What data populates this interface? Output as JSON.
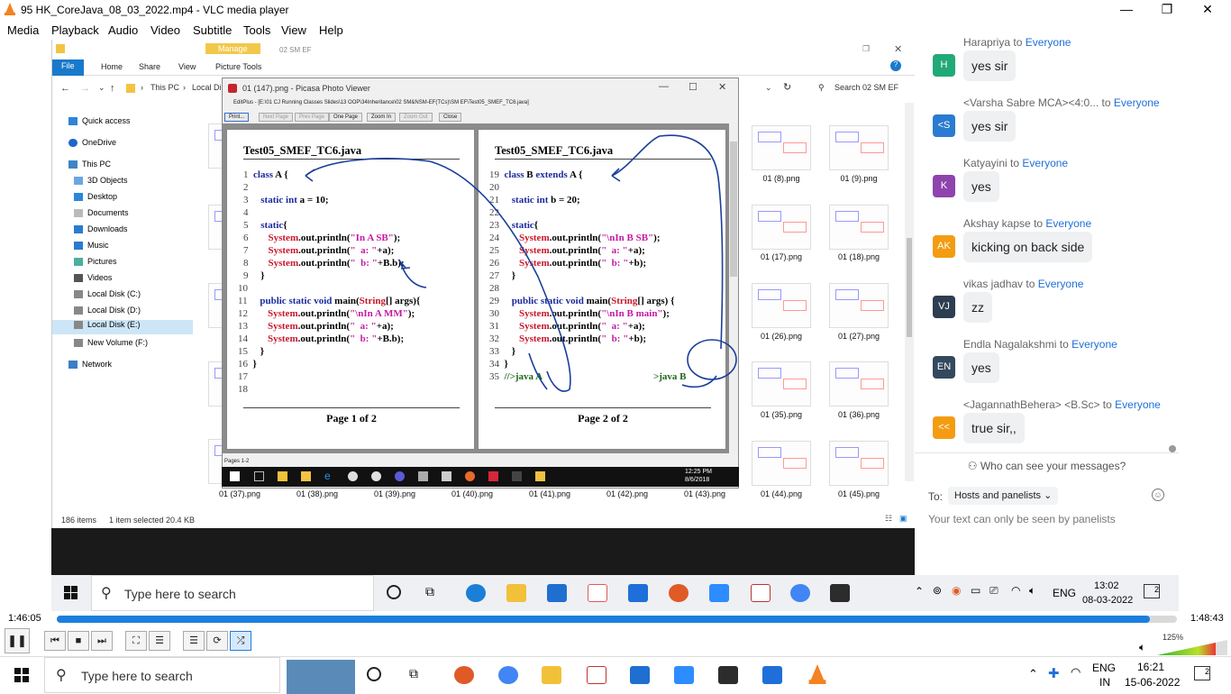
{
  "window": {
    "title": "95 HK_CoreJava_08_03_2022.mp4 - VLC media player"
  },
  "menu": [
    "Media",
    "Playback",
    "Audio",
    "Video",
    "Subtitle",
    "Tools",
    "View",
    "Help"
  ],
  "explorer": {
    "manage_tab": "Manage",
    "window_title": "02 SM EF",
    "ribbon": [
      "File",
      "Home",
      "Share",
      "View",
      "Picture Tools"
    ],
    "path": [
      "This PC",
      "Local Di"
    ],
    "search_placeholder": "Search 02 SM EF",
    "sidebar": [
      "Quick access",
      "OneDrive",
      "This PC",
      "3D Objects",
      "Desktop",
      "Documents",
      "Downloads",
      "Music",
      "Pictures",
      "Videos",
      "Local Disk (C:)",
      "Local Disk (D:)",
      "Local Disk (E:)",
      "New Volume (F:)",
      "Network"
    ],
    "right_thumbs": [
      "01 (8).png",
      "01 (9).png",
      "01 (17).png",
      "01 (18).png",
      "01 (26).png",
      "01 (27).png",
      "01 (35).png",
      "01 (36).png",
      "01 (44).png",
      "01 (45).png"
    ],
    "bottom_thumbs": [
      "01 (37).png",
      "01 (38).png",
      "01 (39).png",
      "01 (40).png",
      "01 (41).png",
      "01 (42).png",
      "01 (43).png"
    ],
    "status_items": "186 items",
    "status_selected": "1 item selected  20.4 KB"
  },
  "picasa": {
    "title": "01 (147).png - Picasa Photo Viewer",
    "edit_path": "EditPlus - [E:\\01 CJ Running Classes Slides\\13 OOP\\34Inheritance\\02 SM&NSM-EF(TCs)\\SM EF\\Test05_SMEF_TC6.java]",
    "buttons": [
      "Print...",
      "Next Page",
      "Prev Page",
      "One Page",
      "Zoom In",
      "Zoom Out",
      "Close"
    ],
    "pages_label": "Pages 1-2",
    "taskbar_time": "12:25 PM",
    "taskbar_date": "8/6/2018",
    "page1": {
      "header": "Test05_SMEF_TC6.java",
      "footer": "Page 1 of 2",
      "lines": [
        {
          "n": "1",
          "t": "class A {"
        },
        {
          "n": "2",
          "t": ""
        },
        {
          "n": "3",
          "t": "static int a = 10;"
        },
        {
          "n": "4",
          "t": ""
        },
        {
          "n": "5",
          "t": "static{"
        },
        {
          "n": "6",
          "t": "System.out.println(\"In A SB\");"
        },
        {
          "n": "7",
          "t": "System.out.println(\"  a: \"+a);"
        },
        {
          "n": "8",
          "t": "System.out.println(\"  b: \"+B.b);"
        },
        {
          "n": "9",
          "t": "}"
        },
        {
          "n": "10",
          "t": ""
        },
        {
          "n": "11",
          "t": "public static void main(String[] args){"
        },
        {
          "n": "12",
          "t": "System.out.println(\"\\nIn A MM\");"
        },
        {
          "n": "13",
          "t": "System.out.println(\"  a: \"+a);"
        },
        {
          "n": "14",
          "t": "System.out.println(\"  b: \"+B.b);"
        },
        {
          "n": "15",
          "t": "}"
        },
        {
          "n": "16",
          "t": "}"
        },
        {
          "n": "17",
          "t": ""
        },
        {
          "n": "18",
          "t": ""
        }
      ]
    },
    "page2": {
      "header": "Test05_SMEF_TC6.java",
      "footer": "Page 2 of 2",
      "lines": [
        {
          "n": "19",
          "t": "class B extends A {"
        },
        {
          "n": "20",
          "t": ""
        },
        {
          "n": "21",
          "t": "static int b = 20;"
        },
        {
          "n": "22",
          "t": ""
        },
        {
          "n": "23",
          "t": "static{"
        },
        {
          "n": "24",
          "t": "System.out.println(\"\\nIn B SB\");"
        },
        {
          "n": "25",
          "t": "System.out.println(\"  a: \"+a);"
        },
        {
          "n": "26",
          "t": "System.out.println(\"  b: \"+b);"
        },
        {
          "n": "27",
          "t": "}"
        },
        {
          "n": "28",
          "t": ""
        },
        {
          "n": "29",
          "t": "public static void main(String[] args) {"
        },
        {
          "n": "30",
          "t": "System.out.println(\"\\nIn B main\");"
        },
        {
          "n": "31",
          "t": "System.out.println(\"  a: \"+a);"
        },
        {
          "n": "32",
          "t": "System.out.println(\"  b: \"+b);"
        },
        {
          "n": "33",
          "t": "}"
        },
        {
          "n": "34",
          "t": "}"
        },
        {
          "n": "35",
          "t": "//>java A"
        }
      ],
      "note": ">java B"
    }
  },
  "chat": {
    "messages": [
      {
        "from": "Harapriya",
        "to": "to",
        "audience": "Everyone",
        "initials": "H",
        "color": "#22a978",
        "text": "yes sir"
      },
      {
        "from": "<Varsha Sabre MCA><4:0...",
        "to": "to",
        "audience": "Everyone",
        "initials": "<S",
        "color": "#2b7bd0",
        "text": "yes sir"
      },
      {
        "from": "Katyayini",
        "to": "to",
        "audience": "Everyone",
        "initials": "K",
        "color": "#8e44ad",
        "text": "yes"
      },
      {
        "from": "Akshay kapse",
        "to": "to",
        "audience": "Everyone",
        "initials": "AK",
        "color": "#f39c12",
        "text": "kicking on back side"
      },
      {
        "from": "vikas jadhav",
        "to": "to",
        "audience": "Everyone",
        "initials": "VJ",
        "color": "#2c3e50",
        "text": "zz"
      },
      {
        "from": "Endla Nagalakshmi",
        "to": "to",
        "audience": "Everyone",
        "initials": "EN",
        "color": "#34495e",
        "text": "yes"
      },
      {
        "from": "<JagannathBehera> <B.Sc>",
        "to": "to",
        "audience": "Everyone",
        "initials": "<<",
        "color": "#f39c12",
        "text": "true sir,,"
      }
    ],
    "who_can_see": "Who can see your messages?",
    "to_label": "To:",
    "to_value": "Hosts and panelists",
    "hint": "Your text can only be seen by panelists"
  },
  "inner_taskbar": {
    "search": "Type here to search",
    "lang": "ENG",
    "time": "13:02",
    "date": "08-03-2022",
    "notif": "2"
  },
  "player": {
    "elapsed": "1:46:05",
    "total": "1:48:43",
    "progress": 0.976,
    "volume": "125%"
  },
  "outer_taskbar": {
    "search": "Type here to search",
    "lang": "ENG",
    "lang2": "IN",
    "time": "16:21",
    "date": "15-06-2022",
    "notif": "2"
  }
}
